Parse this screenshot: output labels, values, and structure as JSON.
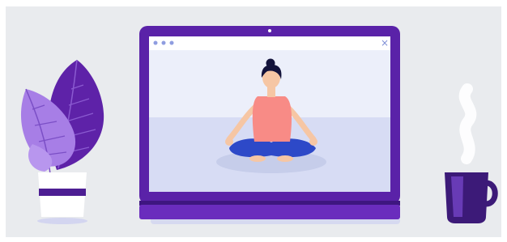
{
  "scene": {
    "description_icons": [
      "plant-icon",
      "laptop-icon",
      "meditating-person-icon",
      "coffee-mug-icon",
      "steam-icon"
    ],
    "window": {
      "close_glyph": "×"
    },
    "colors": {
      "background": "#e9ebee",
      "laptop_frame": "#5a22a8",
      "laptop_base": "#6a2cbd",
      "screen_top": "#eceffa",
      "floor": "#d7dcf4",
      "mat": "#c9cfe8",
      "window_bar": "#ffffff",
      "window_dots": "#8f9de0",
      "person_shirt": "#f88b86",
      "person_pants": "#2d49c8",
      "person_hair": "#13133b",
      "person_skin": "#f6c6a4",
      "plant_dark": "#6a2cb3",
      "plant_light": "#a77ee6",
      "pot": "#ffffff",
      "pot_band": "#5a22a8",
      "mug": "#3c1a78",
      "mug_highlight": "#6a3db5",
      "steam": "#ffffff"
    }
  }
}
